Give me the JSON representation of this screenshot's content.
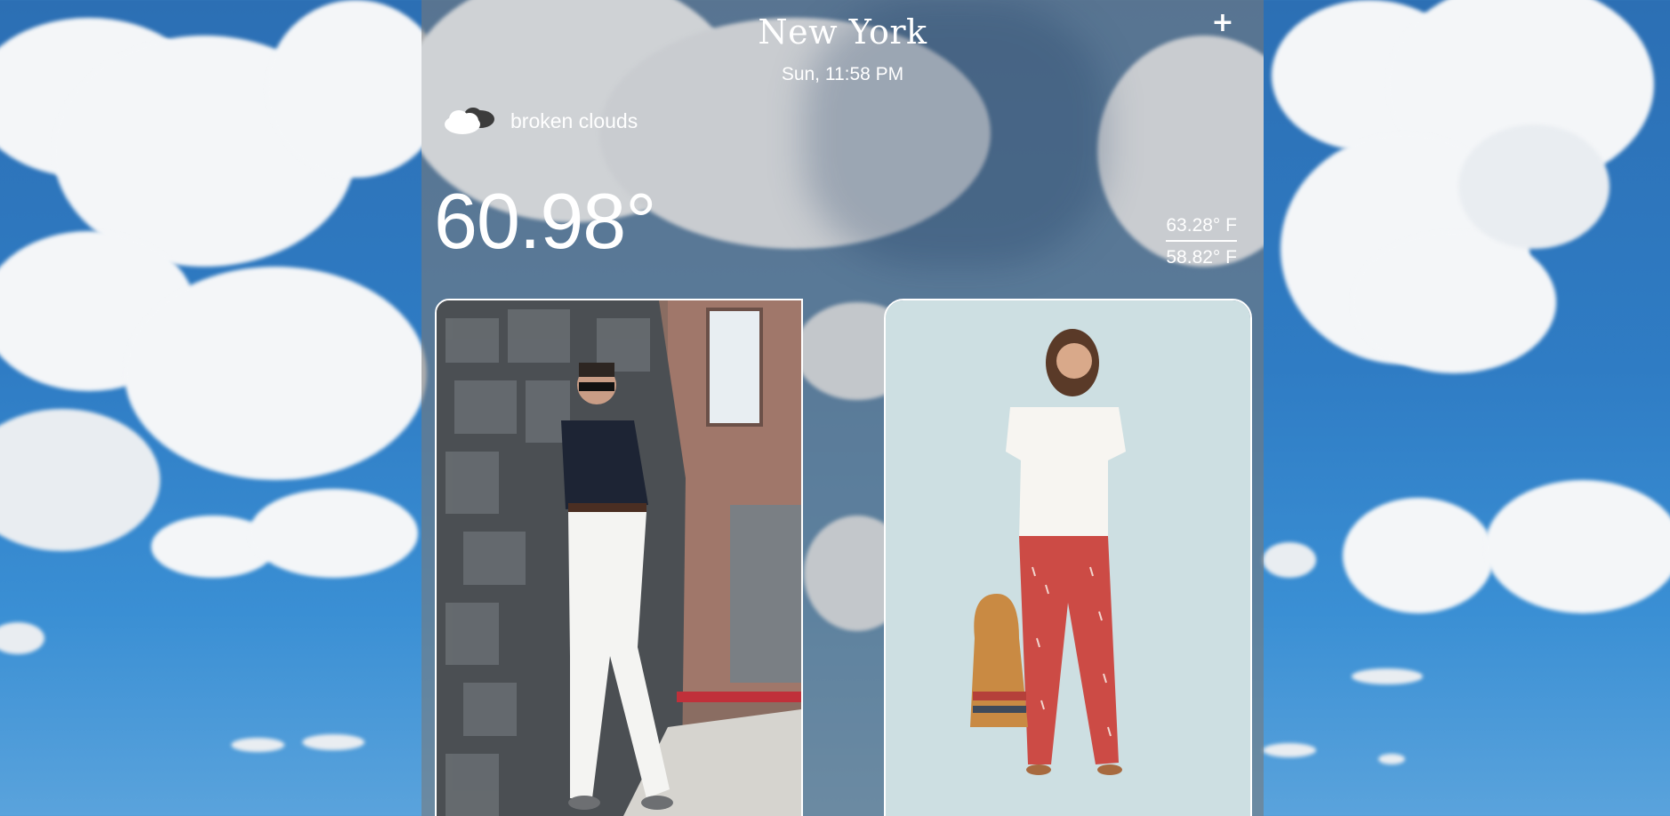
{
  "location": {
    "city": "New York",
    "datetime": "Sun, 11:58 PM"
  },
  "header": {
    "add_label": "+"
  },
  "weather": {
    "icon": "broken-clouds-icon",
    "description": "broken clouds",
    "temperature": "60.98°",
    "high": "63.28° F",
    "low": "58.82° F"
  },
  "outfits": [
    {
      "label": "men outfit: navy polo, white trousers, grey loafers"
    },
    {
      "label": "women outfit: white blouse, red patterned trousers, straw bag"
    }
  ],
  "colors": {
    "sky": "#2f7cc4",
    "panel_overlay": "#787878",
    "text": "#ffffff"
  }
}
